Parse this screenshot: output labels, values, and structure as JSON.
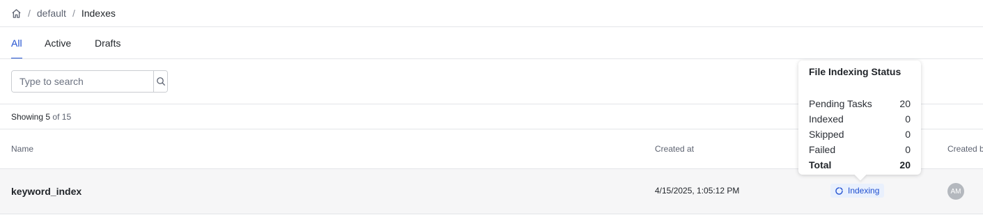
{
  "breadcrumb": {
    "items": [
      "default",
      "Indexes"
    ],
    "separator": "/"
  },
  "tabs": [
    {
      "label": "All",
      "active": true
    },
    {
      "label": "Active",
      "active": false
    },
    {
      "label": "Drafts",
      "active": false
    }
  ],
  "search": {
    "placeholder": "Type to search",
    "value": ""
  },
  "summary": {
    "prefix": "Showing",
    "shown": "5",
    "of_word": "of",
    "total": "15"
  },
  "table": {
    "columns": [
      "Name",
      "Created at",
      "Created b"
    ],
    "rows": [
      {
        "name": "keyword_index",
        "created_at": "4/15/2025, 1:05:12 PM",
        "status": "Indexing",
        "created_by": "AM"
      }
    ]
  },
  "popover": {
    "title": "File Indexing Status",
    "rows": [
      {
        "label": "Pending Tasks",
        "value": "20"
      },
      {
        "label": "Indexed",
        "value": "0"
      },
      {
        "label": "Skipped",
        "value": "0"
      },
      {
        "label": "Failed",
        "value": "0"
      }
    ],
    "total": {
      "label": "Total",
      "value": "20"
    }
  },
  "colors": {
    "accent": "#1f4fd0",
    "status_bg": "#e9f0fd",
    "row_bg": "#f6f6f7",
    "avatar_bg": "#b4b8be"
  },
  "icons": [
    "home-icon",
    "search-icon",
    "spinner-icon"
  ]
}
